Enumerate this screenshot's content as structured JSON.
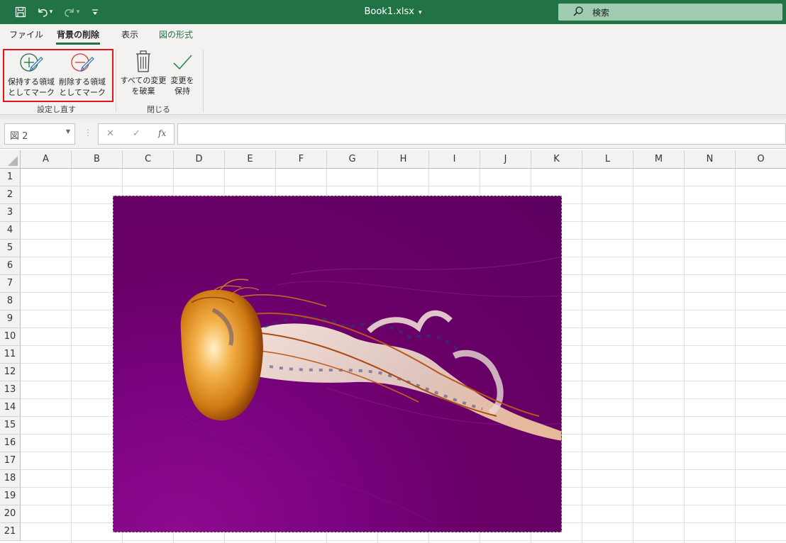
{
  "titlebar": {
    "title": "Book1.xlsx",
    "search_label": "検索",
    "save_icon": "save-icon",
    "undo_icon": "undo-icon",
    "redo_icon": "redo-icon"
  },
  "tabs": [
    {
      "label": "ファイル"
    },
    {
      "label": "背景の削除"
    },
    {
      "label": "表示"
    },
    {
      "label": "図の形式"
    }
  ],
  "ribbon": {
    "refine_group": {
      "label": "設定し直す",
      "keep": {
        "line1": "保持する領域",
        "line2": "としてマーク"
      },
      "remove": {
        "line1": "削除する領域",
        "line2": "としてマーク"
      }
    },
    "close_group": {
      "label": "閉じる",
      "discard": {
        "line1": "すべての変更",
        "line2": "を破棄"
      },
      "keep_changes": {
        "line1": "変更を",
        "line2": "保持"
      }
    }
  },
  "formula_bar": {
    "name_box": "図 2",
    "cancel_glyph": "✕",
    "enter_glyph": "✓",
    "fx_label": "fx",
    "formula": ""
  },
  "sheet": {
    "columns": [
      "A",
      "B",
      "C",
      "D",
      "E",
      "F",
      "G",
      "H",
      "I",
      "J",
      "K",
      "L",
      "M",
      "N",
      "O"
    ],
    "rows": [
      "1",
      "2",
      "3",
      "4",
      "5",
      "6",
      "7",
      "8",
      "9",
      "10",
      "11",
      "12",
      "13",
      "14",
      "15",
      "16",
      "17",
      "18",
      "19",
      "20",
      "21"
    ]
  },
  "colors": {
    "accent": "#217346",
    "highlight": "#e4131c",
    "picture_bg": "#6a0068"
  }
}
